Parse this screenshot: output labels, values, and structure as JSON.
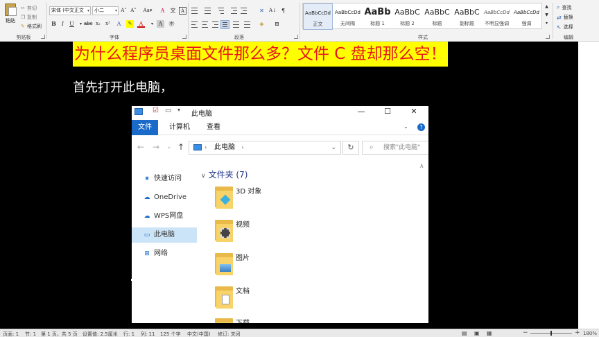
{
  "ribbon": {
    "clipboard": {
      "paste": "粘贴",
      "cut": "剪切",
      "copy": "复制",
      "format_painter": "格式刷",
      "group": "剪贴板"
    },
    "font": {
      "name": "宋体 (中文正文",
      "size": "小二",
      "group": "字体"
    },
    "paragraph": {
      "group": "段落"
    },
    "styles": {
      "group": "样式",
      "items": [
        {
          "preview": "AaBbCcDd",
          "name": "正文"
        },
        {
          "preview": "AaBbCcDd",
          "name": "无间隔"
        },
        {
          "preview": "AaBb",
          "name": "标题 1"
        },
        {
          "preview": "AaBbC",
          "name": "标题 2"
        },
        {
          "preview": "AaBbC",
          "name": "标题"
        },
        {
          "preview": "AaBbC",
          "name": "副标题"
        },
        {
          "preview": "AaBbCcDd",
          "name": "不明显强调"
        },
        {
          "preview": "AaBbCcDd",
          "name": "强调"
        }
      ]
    },
    "editing": {
      "find": "查找",
      "replace": "替换",
      "select": "选择",
      "group": "编辑"
    }
  },
  "doc": {
    "title": "为什么程序员桌面文件那么多？文件 C 盘却那么空！",
    "para": "首先打开此电脑，"
  },
  "explorer": {
    "window_title": "此电脑",
    "tabs": [
      "文件",
      "计算机",
      "查看"
    ],
    "address": "此电脑",
    "search_placeholder": "搜索\"此电脑\"",
    "nav": [
      "快速访问",
      "OneDrive",
      "WPS网盘",
      "此电脑",
      "网络"
    ],
    "section": "文件夹 (7)",
    "folders": [
      "3D 对象",
      "视频",
      "图片",
      "文档",
      "下载"
    ]
  },
  "status": {
    "page": "页面: 1",
    "section": "节: 1",
    "pages": "第 1 页，共 5 页",
    "position": "设置值: 2.5厘米",
    "line": "行: 1",
    "column": "列: 11",
    "words": "125 个字",
    "lang": "中文(中国)",
    "track": "修订: 关闭",
    "zoom": "180%"
  },
  "colors": {
    "title_bg": "#ffff00",
    "title_fg": "#e8161c",
    "file_tab": "#1a6bc9",
    "selected_nav": "#cce4f7"
  }
}
